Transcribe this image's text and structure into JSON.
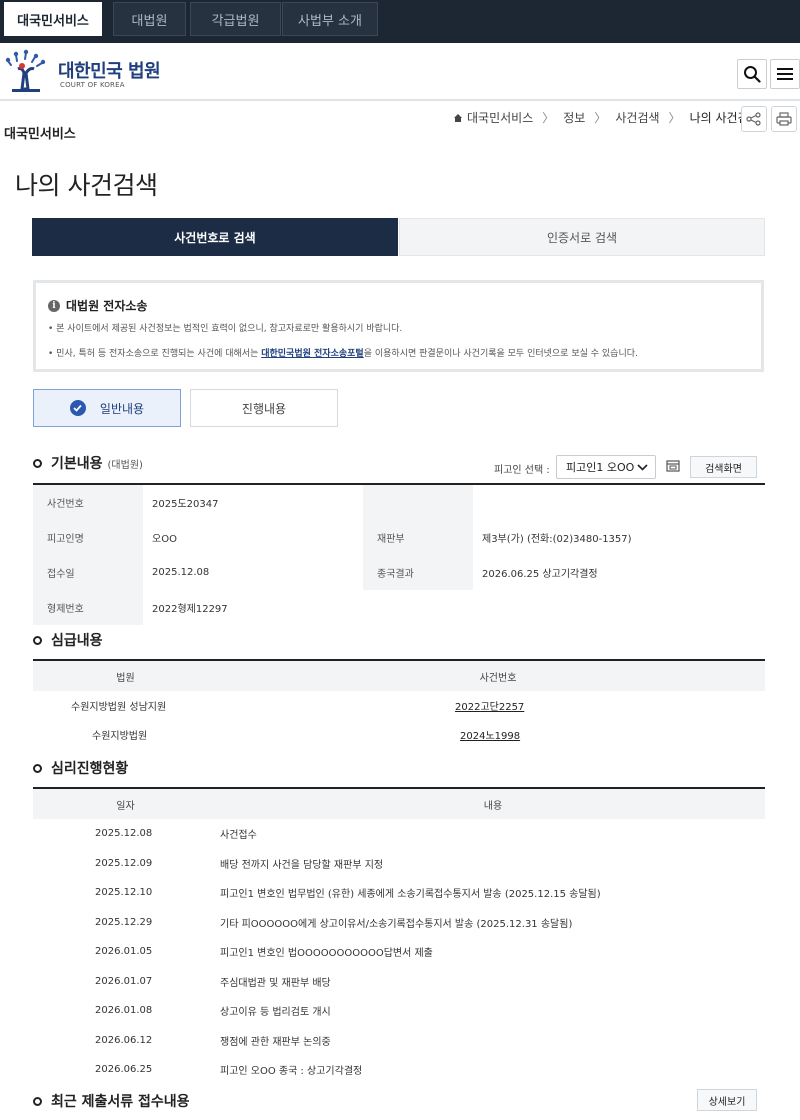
{
  "topnav": {
    "tabs": [
      "대국민서비스",
      "대법원",
      "각급법원",
      "사법부 소개"
    ]
  },
  "header": {
    "logo_title": "대한민국 법원",
    "logo_sub": "COURT OF KOREA",
    "search_icon": "search-icon",
    "menu_icon": "hamburger-menu-icon"
  },
  "section_name": "대국민서비스",
  "breadcrumb": {
    "home": "대국민서비스",
    "items": [
      "정보",
      "사건검색",
      "나의 사건검색"
    ]
  },
  "page_title": "나의 사건검색",
  "search_tabs": [
    "사건번호로 검색",
    "인증서로 검색"
  ],
  "notice": {
    "title": "대법원 전자소송",
    "line1": "• 본 사이트에서 제공된 사건정보는 법적인 효력이 없으니, 참고자료로만 활용하시기 바랍니다.",
    "line2_pre": "• 민사, 특허 등 전자소송으로 진행되는 사건에 대해서는 ",
    "line2_link": "대한민국법원 전자소송포털",
    "line2_post": "을 이용하시면 판결문이나 사건기록을 모두 인터넷으로 보실 수 있습니다."
  },
  "content_tabs": [
    "일반내용",
    "진행내용"
  ],
  "basic": {
    "title": "기본내용",
    "subtitle": "(대법원)",
    "defendant_label": "피고인 선택 :",
    "defendant_selected": "피고인1 오OO",
    "search_screen_button": "검색화면",
    "rows": [
      {
        "label": "사건번호",
        "value": "2025도20347",
        "label2": "",
        "value2": ""
      },
      {
        "label": "피고인명",
        "value": "오OO",
        "label2": "재판부",
        "value2": "제3부(가) (전화:(02)3480-1357)"
      },
      {
        "label": "접수일",
        "value": "2025.12.08",
        "label2": "종국결과",
        "value2": "2026.06.25 상고기각결정"
      },
      {
        "label": "형제번호",
        "value": "2022형제12297",
        "label2": "",
        "value2": ""
      }
    ]
  },
  "lower_court": {
    "title": "심급내용",
    "headers": [
      "법원",
      "사건번호"
    ],
    "rows": [
      {
        "court": "수원지방법원 성남지원",
        "case": "2022고단2257"
      },
      {
        "court": "수원지방법원",
        "case": "2024노1998"
      }
    ]
  },
  "progress": {
    "title": "심리진행현황",
    "headers": [
      "일자",
      "내용"
    ],
    "rows": [
      {
        "date": "2025.12.08",
        "content": "사건접수"
      },
      {
        "date": "2025.12.09",
        "content": "배당 전까지 사건을 담당할 재판부 지정"
      },
      {
        "date": "2025.12.10",
        "content": "피고인1 변호인 법무법인 (유한) 세종에게 소송기록접수통지서 발송 (2025.12.15 송달됨)"
      },
      {
        "date": "2025.12.29",
        "content": "기타 피OOOOOO에게 상고이유서/소송기록접수통지서 발송 (2025.12.31 송달됨)"
      },
      {
        "date": "2026.01.05",
        "content": "피고인1 변호인 법OOOOOOOOOOO답변서 제출"
      },
      {
        "date": "2026.01.07",
        "content": "주심대법관 및 재판부 배당"
      },
      {
        "date": "2026.01.08",
        "content": "상고이유 등 법리검토 개시"
      },
      {
        "date": "2026.06.12",
        "content": "쟁점에 관한 재판부 논의중"
      },
      {
        "date": "2026.06.25",
        "content": "피고인 오OO 종국 : 상고기각결정"
      }
    ]
  },
  "recent_docs": {
    "title": "최근 제출서류 접수내용",
    "detail_button": "상세보기"
  }
}
